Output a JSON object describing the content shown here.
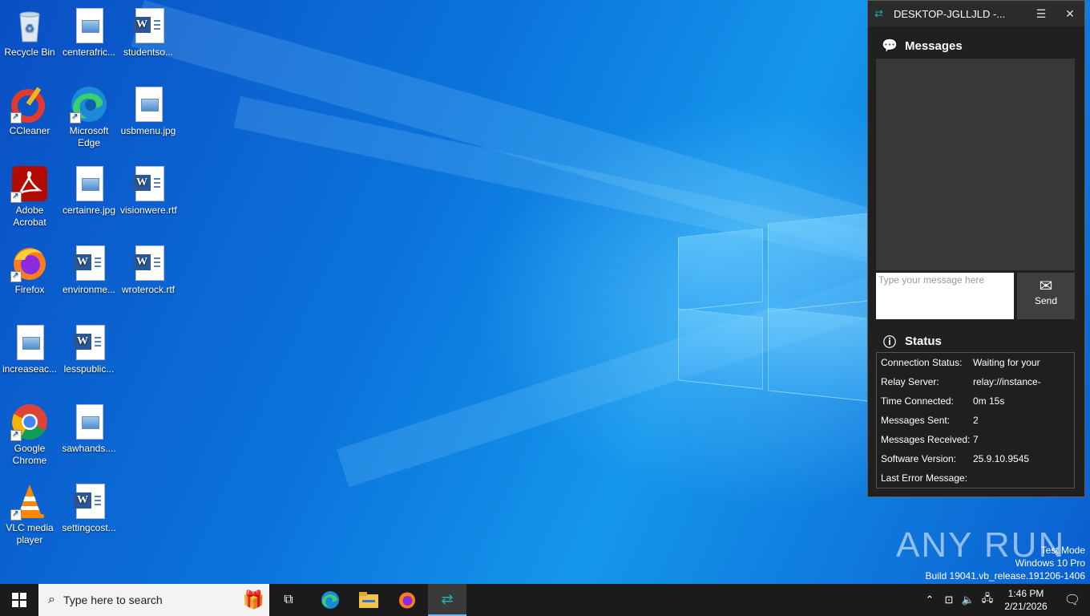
{
  "desktop": {
    "icons": [
      {
        "label": "Recycle Bin"
      },
      {
        "label": "centerafric..."
      },
      {
        "label": "studentso..."
      },
      {
        "label": "CCleaner"
      },
      {
        "label": "Microsoft Edge"
      },
      {
        "label": "usbmenu.jpg"
      },
      {
        "label": "Adobe Acrobat"
      },
      {
        "label": "certainre.jpg"
      },
      {
        "label": "visionwere.rtf"
      },
      {
        "label": "Firefox"
      },
      {
        "label": "environme..."
      },
      {
        "label": "wroterock.rtf"
      },
      {
        "label": "increaseac..."
      },
      {
        "label": "lesspublic..."
      },
      {
        "label": "Google Chrome"
      },
      {
        "label": "sawhands...."
      },
      {
        "label": "VLC media player"
      },
      {
        "label": "settingcost..."
      }
    ]
  },
  "window": {
    "title": "DESKTOP-JGLLJLD -...",
    "messages_heading": "Messages",
    "input_placeholder": "Type your message here",
    "send_label": "Send",
    "status_heading": "Status",
    "status_rows": [
      {
        "key": "Connection Status:",
        "value": "Waiting for your"
      },
      {
        "key": "Relay Server:",
        "value": "relay://instance-"
      },
      {
        "key": "Time Connected:",
        "value": "0m 15s"
      },
      {
        "key": "Messages Sent:",
        "value": "2"
      },
      {
        "key": "Messages Received:",
        "value": "7"
      },
      {
        "key": "Software Version:",
        "value": "25.9.10.9545"
      },
      {
        "key": "Last Error Message:",
        "value": ""
      }
    ]
  },
  "watermark": {
    "brand": "ANY RUN",
    "line1": "Test Mode",
    "line2": "Windows 10 Pro",
    "line3": "Build 19041.vb_release.191206-1406"
  },
  "taskbar": {
    "search_placeholder": "Type here to search",
    "time": "1:46 PM",
    "date": "2/21/2026"
  },
  "colors": {
    "desktop_blue": "#0b74dc",
    "window_bg": "#202020",
    "accent_teal": "#17b6b0",
    "taskbar_bg": "#1b1b1b"
  }
}
